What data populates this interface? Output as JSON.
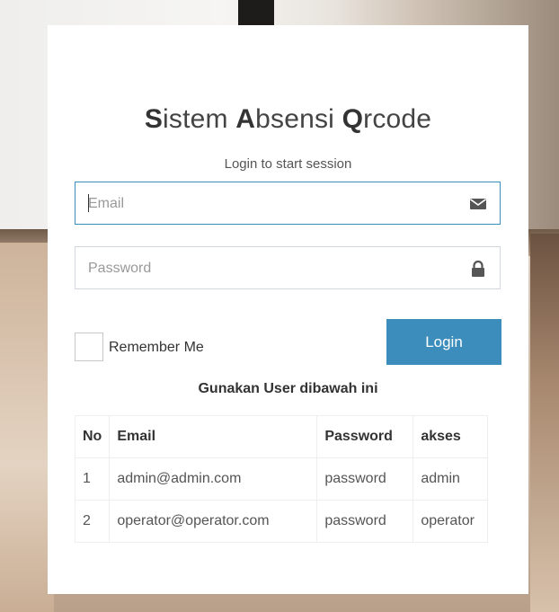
{
  "title": {
    "s_letter": "S",
    "s_rest": "istem ",
    "a_letter": "A",
    "a_rest": "bsensi ",
    "q_letter": "Q",
    "q_rest": "rcode"
  },
  "subtitle": "Login to start session",
  "form": {
    "email_placeholder": "Email",
    "password_placeholder": "Password",
    "email_icon": "envelope-icon",
    "password_icon": "lock-icon",
    "remember_label": "Remember Me",
    "login_label": "Login"
  },
  "colors": {
    "primary": "#3c8dbc"
  },
  "hint": "Gunakan User dibawah ini",
  "users_table": {
    "headers": [
      "No",
      "Email",
      "Password",
      "akses"
    ],
    "rows": [
      [
        "1",
        "admin@admin.com",
        "password",
        "admin"
      ],
      [
        "2",
        "operator@operator.com",
        "password",
        "operator"
      ]
    ]
  }
}
